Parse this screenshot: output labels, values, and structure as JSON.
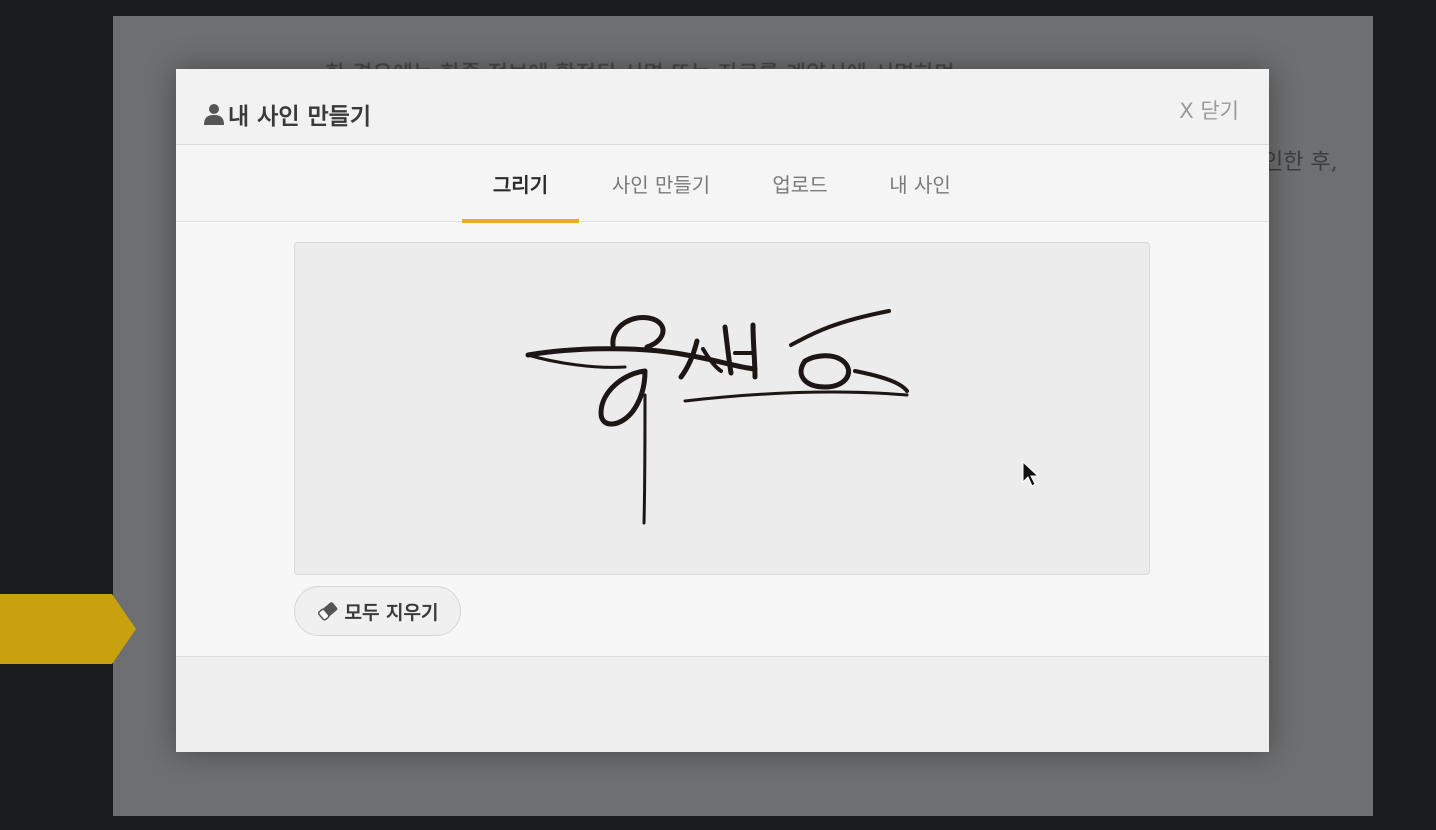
{
  "backdrop": {
    "line1": "한 경우에는 한줄 정보에 확정된 서명 또는 자료를 계약서에 서명하며",
    "line2": "인한 후,"
  },
  "modal": {
    "title": "내 사인 만들기",
    "close_label": "X 닫기",
    "title_icon": "user-icon"
  },
  "tabs": [
    {
      "label": "그리기",
      "active": true
    },
    {
      "label": "사인 만들기",
      "active": false
    },
    {
      "label": "업로드",
      "active": false
    },
    {
      "label": "내 사인",
      "active": false
    }
  ],
  "canvas": {
    "signature_icon": "handwritten-signature"
  },
  "clear_button": {
    "label": "모두 지우기",
    "icon": "eraser-icon"
  },
  "colors": {
    "accent": "#e6ac22",
    "side_tab": "#c8a10f"
  }
}
